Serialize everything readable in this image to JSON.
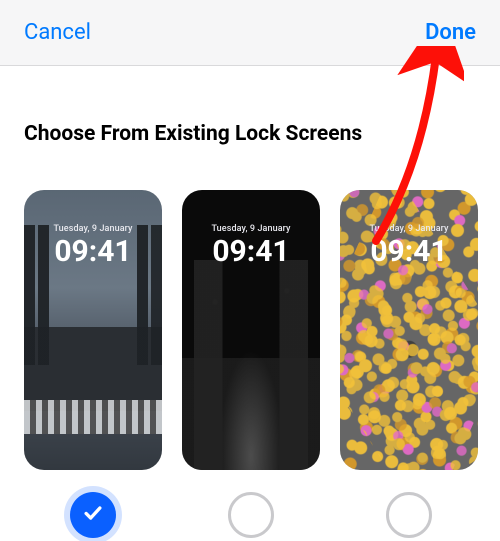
{
  "navbar": {
    "cancel_label": "Cancel",
    "done_label": "Done"
  },
  "section": {
    "title": "Choose From Existing Lock Screens"
  },
  "lock_screens": [
    {
      "date": "Tuesday, 9 January",
      "time": "09:41",
      "style": "city",
      "selected": true
    },
    {
      "date": "Tuesday, 9 January",
      "time": "09:41",
      "style": "dark",
      "selected": false
    },
    {
      "date": "Tuesday, 9 January",
      "time": "09:41",
      "style": "emoji",
      "selected": false
    }
  ],
  "colors": {
    "ios_blue": "#007aff",
    "selected_blue": "#0a60ff",
    "arrow_red": "#fd1008"
  }
}
